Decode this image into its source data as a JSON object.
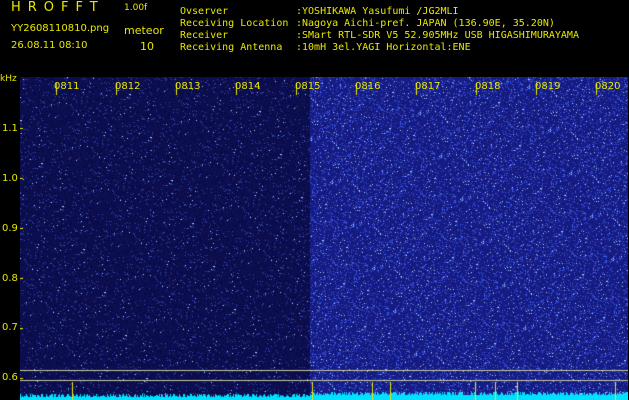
{
  "header": {
    "app_title": "HROFFT",
    "version": "1.00f",
    "filename": "YY2608110810.png",
    "datetime": "26.08.11 08:10",
    "meteor_label": "meteor",
    "meteor_count": "10"
  },
  "station": [
    {
      "key": "Ovserver",
      "value": ":YOSHIKAWA Yasufumi /JG2MLI"
    },
    {
      "key": "Receiving Location",
      "value": ":Nagoya Aichi-pref. JAPAN (136.90E, 35.20N)"
    },
    {
      "key": "Receiver",
      "value": ":SMart RTL-SDR V5 52.905MHz USB HIGASHIMURAYAMA"
    },
    {
      "key": "Receiving Antenna",
      "value": ":10mH 3el.YAGI Horizontal:ENE"
    }
  ],
  "axis": {
    "y_unit": "kHz",
    "y_ticks": [
      "1.1",
      "1.0",
      "0.9",
      "0.8",
      "0.7",
      "0.6"
    ],
    "time_ticks": [
      "0811",
      "0812",
      "0813",
      "0814",
      "0815",
      "0816",
      "0817",
      "0818",
      "0819",
      "0820"
    ]
  },
  "colors": {
    "text": "#e8e800",
    "background": "#000000",
    "spectrogram_dark": "#0c0f4a",
    "spectrogram_light": "#1a2290",
    "baseline": "#00e0ff"
  }
}
